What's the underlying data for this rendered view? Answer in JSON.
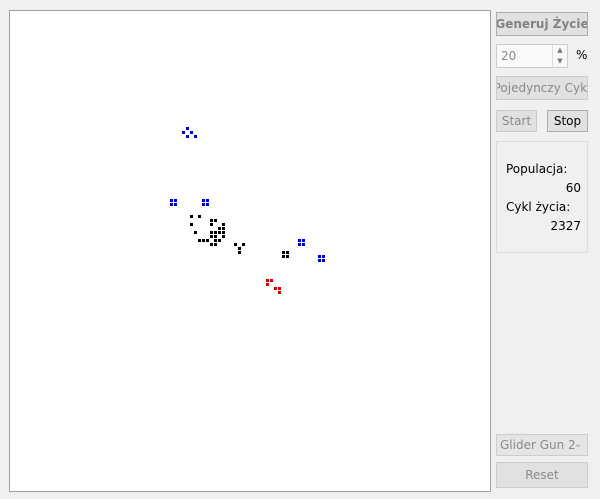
{
  "controls": {
    "generate_label": "Generuj Życie",
    "percent_value": "20",
    "percent_unit": "%",
    "single_cycle_label": "Pojedynczy Cykl",
    "start_label": "Start",
    "stop_label": "Stop",
    "pattern_selected": "Glider Gun 2",
    "reset_label": "Reset"
  },
  "stats": {
    "population_label": "Populacja:",
    "population_value": "60",
    "cycle_label": "Cykl życia:",
    "cycle_value": "2327"
  },
  "icons": {
    "spin_up": "spin-up-arrow-icon",
    "spin_down": "spin-down-arrow-icon",
    "combo_chevron": "chevron-down-icon"
  },
  "colors": {
    "blue_cells": "#0000cc",
    "black_cells": "#000000",
    "red_cells": "#cc0000"
  },
  "grid": {
    "cell_size": 4,
    "cells": [
      {
        "c": "b",
        "x": 44,
        "y": 29
      },
      {
        "c": "b",
        "x": 43,
        "y": 30
      },
      {
        "c": "b",
        "x": 45,
        "y": 30
      },
      {
        "c": "b",
        "x": 44,
        "y": 31
      },
      {
        "c": "b",
        "x": 46,
        "y": 31
      },
      {
        "c": "b",
        "x": 40,
        "y": 47
      },
      {
        "c": "b",
        "x": 41,
        "y": 47
      },
      {
        "c": "b",
        "x": 40,
        "y": 48
      },
      {
        "c": "b",
        "x": 41,
        "y": 48
      },
      {
        "c": "b",
        "x": 48,
        "y": 47
      },
      {
        "c": "b",
        "x": 49,
        "y": 47
      },
      {
        "c": "b",
        "x": 48,
        "y": 48
      },
      {
        "c": "b",
        "x": 49,
        "y": 48
      },
      {
        "c": "b",
        "x": 72,
        "y": 57
      },
      {
        "c": "b",
        "x": 73,
        "y": 57
      },
      {
        "c": "b",
        "x": 72,
        "y": 58
      },
      {
        "c": "b",
        "x": 73,
        "y": 58
      },
      {
        "c": "b",
        "x": 77,
        "y": 61
      },
      {
        "c": "b",
        "x": 78,
        "y": 61
      },
      {
        "c": "b",
        "x": 77,
        "y": 62
      },
      {
        "c": "b",
        "x": 78,
        "y": 62
      },
      {
        "c": "k",
        "x": 45,
        "y": 51
      },
      {
        "c": "k",
        "x": 47,
        "y": 51
      },
      {
        "c": "k",
        "x": 50,
        "y": 52
      },
      {
        "c": "k",
        "x": 51,
        "y": 52
      },
      {
        "c": "k",
        "x": 45,
        "y": 53
      },
      {
        "c": "k",
        "x": 50,
        "y": 53
      },
      {
        "c": "k",
        "x": 53,
        "y": 53
      },
      {
        "c": "k",
        "x": 52,
        "y": 54
      },
      {
        "c": "k",
        "x": 53,
        "y": 54
      },
      {
        "c": "k",
        "x": 46,
        "y": 55
      },
      {
        "c": "k",
        "x": 50,
        "y": 55
      },
      {
        "c": "k",
        "x": 51,
        "y": 55
      },
      {
        "c": "k",
        "x": 52,
        "y": 55
      },
      {
        "c": "k",
        "x": 53,
        "y": 55
      },
      {
        "c": "k",
        "x": 50,
        "y": 56
      },
      {
        "c": "k",
        "x": 51,
        "y": 56
      },
      {
        "c": "k",
        "x": 53,
        "y": 56
      },
      {
        "c": "k",
        "x": 47,
        "y": 57
      },
      {
        "c": "k",
        "x": 48,
        "y": 57
      },
      {
        "c": "k",
        "x": 49,
        "y": 57
      },
      {
        "c": "k",
        "x": 51,
        "y": 57
      },
      {
        "c": "k",
        "x": 52,
        "y": 57
      },
      {
        "c": "k",
        "x": 50,
        "y": 58
      },
      {
        "c": "k",
        "x": 51,
        "y": 58
      },
      {
        "c": "k",
        "x": 56,
        "y": 58
      },
      {
        "c": "k",
        "x": 58,
        "y": 58
      },
      {
        "c": "k",
        "x": 57,
        "y": 59
      },
      {
        "c": "k",
        "x": 57,
        "y": 60
      },
      {
        "c": "k",
        "x": 68,
        "y": 60
      },
      {
        "c": "k",
        "x": 69,
        "y": 60
      },
      {
        "c": "k",
        "x": 68,
        "y": 61
      },
      {
        "c": "k",
        "x": 69,
        "y": 61
      },
      {
        "c": "r",
        "x": 64,
        "y": 67
      },
      {
        "c": "r",
        "x": 65,
        "y": 67
      },
      {
        "c": "r",
        "x": 64,
        "y": 68
      },
      {
        "c": "r",
        "x": 66,
        "y": 69
      },
      {
        "c": "r",
        "x": 67,
        "y": 69
      },
      {
        "c": "r",
        "x": 67,
        "y": 70
      }
    ]
  }
}
